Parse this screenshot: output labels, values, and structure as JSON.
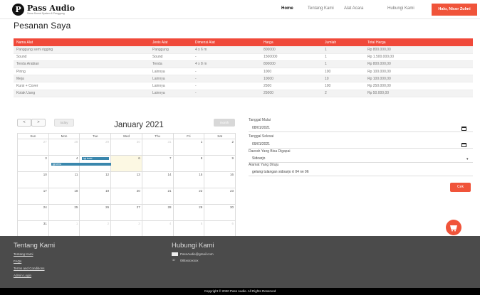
{
  "header": {
    "logo_letter": "P",
    "brand": "Pass Audio",
    "tagline": "Sewa Sound System & Panggung",
    "nav": [
      "Home",
      "Tentang Kami",
      "Alat Acara",
      "Hubungi Kami"
    ],
    "user": "Halo, Nicor Zulmi"
  },
  "page_title": "Pesanan Saya",
  "orders": {
    "columns": [
      "Nama Alat",
      "Jenis Alat",
      "Dimensi Alat",
      "Harga",
      "Jumlah",
      "Total Harga"
    ],
    "rows": [
      [
        "Panggung semi rigging",
        "Panggung",
        "4 x 6 m",
        "800000",
        "1",
        "Rp 800.000,00"
      ],
      [
        "Sound",
        "Sound",
        "-",
        "1500000",
        "1",
        "Rp 1.500.000,00"
      ],
      [
        "Tenda Arabian",
        "Tenda",
        "4 x 8 m",
        "800000",
        "1",
        "Rp 800.000,00"
      ],
      [
        "Piring",
        "Lainnya",
        "-",
        "1000",
        "100",
        "Rp 100.000,00"
      ],
      [
        "Meja",
        "Lainnya",
        "-",
        "10000",
        "10",
        "Rp 100.000,00"
      ],
      [
        "Kursi + Cover",
        "Lainnya",
        "-",
        "2500",
        "100",
        "Rp 250.000,00"
      ],
      [
        "Kotak Uang",
        "Lainnya",
        "-",
        "25000",
        "2",
        "Rp 50.000,00"
      ]
    ]
  },
  "calendar": {
    "prev": "<",
    "next": ">",
    "today": "today",
    "title": "January 2021",
    "view": "month",
    "weekdays": [
      "Sun",
      "Mon",
      "Tue",
      "Wed",
      "Thu",
      "Fri",
      "Sat"
    ],
    "weeks": [
      [
        "27",
        "28",
        "29",
        "30",
        "31",
        "1",
        "2"
      ],
      [
        "3",
        "4",
        "5",
        "6",
        "7",
        "8",
        "9"
      ],
      [
        "10",
        "11",
        "12",
        "13",
        "14",
        "15",
        "16"
      ],
      [
        "17",
        "18",
        "19",
        "20",
        "21",
        "22",
        "23"
      ],
      [
        "24",
        "25",
        "26",
        "27",
        "28",
        "29",
        "30"
      ],
      [
        "31",
        "1",
        "2",
        "3",
        "4",
        "5",
        "6"
      ]
    ],
    "event_label": "tgl terisi"
  },
  "form": {
    "start_label": "Tanggal Mulai",
    "start_value": "08/01/2021",
    "end_label": "Tanggal Selesai",
    "end_value": "09/01/2021",
    "area_label": "Daerah Yang Bisa Digapai",
    "area_value": "Sidoarjo",
    "address_label": "Alamat Yang Dituju",
    "address_value": "gelang tulangan sidoarjo rt 04 rw 06",
    "submit": "Cek"
  },
  "footer": {
    "about_title": "Tentang Kami",
    "links": [
      "Tentang Kami",
      "FAQs",
      "Terms and Conditions",
      "Admin Login"
    ],
    "contact_title": "Hubungi Kami",
    "email": "PassAudio@gmail.com",
    "phone": "085xxxxxxxx",
    "copyright": "Copyright © 2020 Pass Audio. All Rights Reserved"
  },
  "colors": {
    "accent": "#f0543a",
    "table_header": "#f0493a",
    "event": "#3a87ad",
    "footer": "#4b4b4b"
  }
}
